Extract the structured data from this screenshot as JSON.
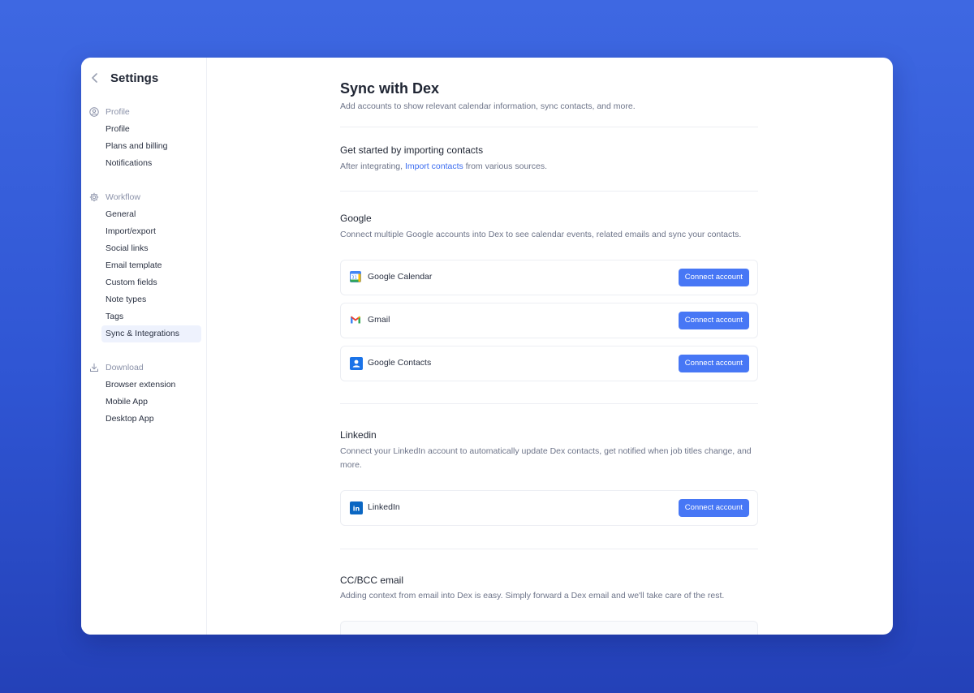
{
  "sidebar": {
    "title": "Settings",
    "sections": [
      {
        "heading": "Profile",
        "icon": "user-circle-icon",
        "items": [
          "Profile",
          "Plans and billing",
          "Notifications"
        ]
      },
      {
        "heading": "Workflow",
        "icon": "gear-icon",
        "items": [
          "General",
          "Import/export",
          "Social links",
          "Email template",
          "Custom fields",
          "Note types",
          "Tags",
          "Sync & Integrations"
        ]
      },
      {
        "heading": "Download",
        "icon": "download-icon",
        "items": [
          "Browser extension",
          "Mobile App",
          "Desktop App"
        ]
      }
    ],
    "active_item": "Sync & Integrations"
  },
  "main": {
    "title": "Sync with Dex",
    "subtitle": "Add accounts to show relevant calendar information, sync contacts, and more.",
    "import": {
      "heading": "Get started by importing contacts",
      "text_before": "After integrating, ",
      "link": "Import contacts",
      "text_after": " from various sources."
    },
    "google": {
      "heading": "Google",
      "description": "Connect multiple Google accounts into Dex to see calendar events, related emails and sync your contacts.",
      "cards": [
        {
          "label": "Google Calendar",
          "icon": "google-calendar-icon",
          "button": "Connect account"
        },
        {
          "label": "Gmail",
          "icon": "gmail-icon",
          "button": "Connect account"
        },
        {
          "label": "Google Contacts",
          "icon": "google-contacts-icon",
          "button": "Connect account"
        }
      ]
    },
    "linkedin": {
      "heading": "Linkedin",
      "description": "Connect your LinkedIn account to automatically update Dex contacts, get notified when job titles change, and more.",
      "cards": [
        {
          "label": "LinkedIn",
          "icon": "linkedin-icon",
          "button": "Connect account"
        }
      ]
    },
    "ccbcc": {
      "heading": "CC/BCC email",
      "description": "Adding context from email into Dex is easy. Simply forward a Dex email and we'll take care of the rest."
    }
  },
  "colors": {
    "accent": "#4777f5",
    "link": "#3b6cf0",
    "background_top": "#3e68e2",
    "background_bottom": "#2441b8"
  }
}
